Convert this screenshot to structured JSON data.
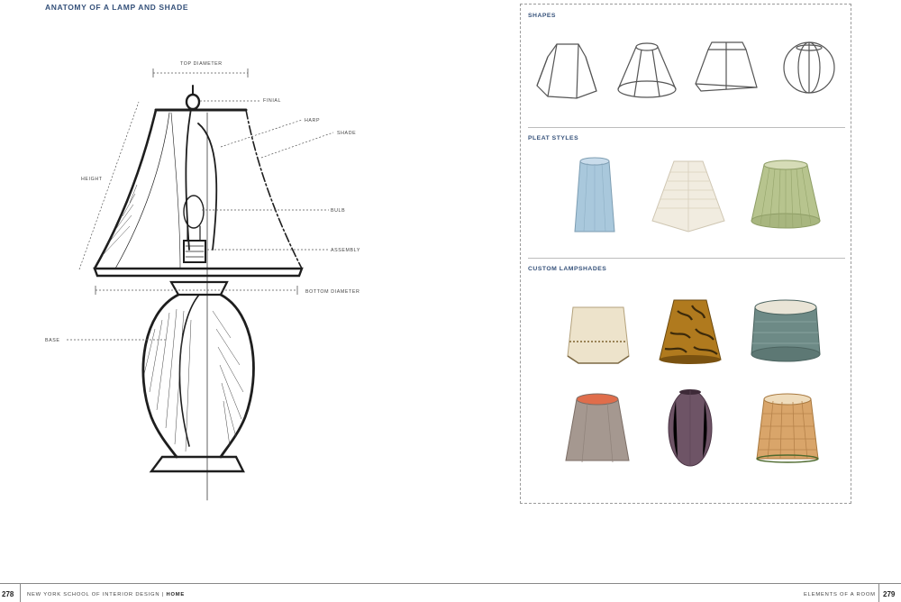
{
  "page_title": "ANATOMY OF A LAMP AND SHADE",
  "diagram_labels": {
    "top_diameter": "TOP DIAMETER",
    "finial": "FINIAL",
    "harp": "HARP",
    "shade": "SHADE",
    "height": "HEIGHT",
    "bulb": "BULB",
    "assembly": "ASSEMBLY",
    "bottom_diameter": "BOTTOM DIAMETER",
    "base": "BASE"
  },
  "panel": {
    "shapes_heading": "SHAPES",
    "pleat_heading": "PLEAT STYLES",
    "custom_heading": "CUSTOM LAMPSHADES"
  },
  "footer": {
    "left_page": "278",
    "left_text": "NEW YORK SCHOOL OF INTERIOR DESIGN",
    "left_sep": " | ",
    "left_bold": "HOME",
    "right_text": "ELEMENTS OF A ROOM",
    "right_page": "279"
  },
  "colors": {
    "heading": "#35517a",
    "pleat_blue": "#a9c8dc",
    "pleat_cream": "#f1ece0",
    "pleat_green": "#b7c48e",
    "custom_cream": "#ede3cb",
    "custom_tiger": "#b07a1e",
    "custom_teal": "#6d8a86",
    "custom_taupe": "#a59890",
    "custom_plum": "#6e5466",
    "custom_plaid": "#d9a56a"
  }
}
